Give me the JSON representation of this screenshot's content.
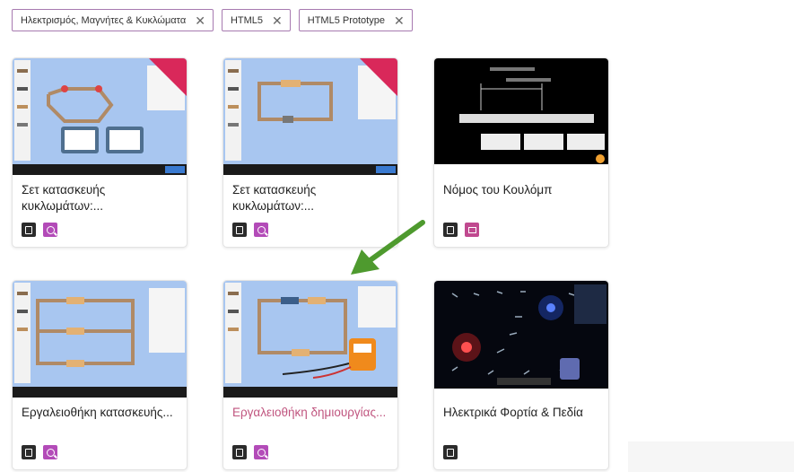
{
  "filters": [
    {
      "label": "Ηλεκτρισμός, Μαγνήτες & Κυκλώματα"
    },
    {
      "label": "HTML5"
    },
    {
      "label": "HTML5 Prototype"
    }
  ],
  "remove_symbol": "✕",
  "sims": [
    {
      "title": "Σετ κατασκευής κυκλωμάτων:...",
      "badge": "NEW",
      "icons": [
        "html5-icon",
        "zoom-icon"
      ]
    },
    {
      "title": "Σετ κατασκευής κυκλωμάτων:...",
      "badge": "NEW",
      "icons": [
        "html5-icon",
        "zoom-icon"
      ]
    },
    {
      "title": "Νόμος του Κουλόμπ",
      "icons": [
        "html5-icon",
        "flash-icon"
      ]
    },
    {
      "title": "Εργαλειοθήκη κατασκευής...",
      "icons": [
        "html5-icon",
        "zoom-icon"
      ]
    },
    {
      "title": "Εργαλειοθήκη δημιουργίας...",
      "icons": [
        "html5-icon",
        "zoom-icon"
      ],
      "highlighted": true
    },
    {
      "title": "Ηλεκτρικά Φορτία & Πεδία",
      "icons": [
        "html5-icon"
      ]
    }
  ],
  "colors": {
    "accent": "#c0557f",
    "chip_border": "#a77ab0",
    "arrow": "#4e9a2e",
    "thumb_bg": "#a8c6f0"
  }
}
